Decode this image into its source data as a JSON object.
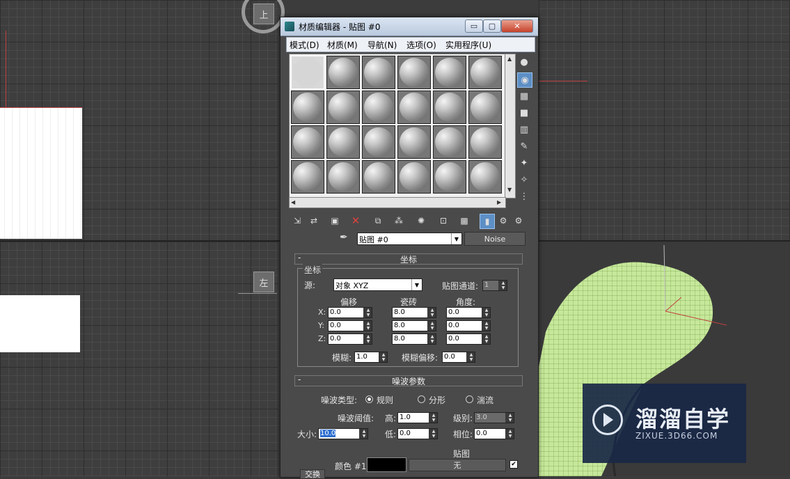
{
  "dialog": {
    "title": "材质编辑器 - 贴图 #0",
    "window_buttons": {
      "minimize": "▭",
      "maximize": "▢",
      "close": "✕"
    }
  },
  "menu": [
    "模式(D)",
    "材质(M)",
    "导航(N)",
    "选项(O)",
    "实用程序(U)"
  ],
  "viewports": {
    "top_left_label": "上",
    "left_label": "左"
  },
  "map_row": {
    "map_name": "贴图 #0",
    "map_type": "Noise"
  },
  "coordinates": {
    "header": "坐标",
    "group_label": "坐标",
    "source_label": "源:",
    "source_value": "对象 XYZ",
    "map_channel_label": "贴图通道:",
    "map_channel_value": "1",
    "col_offset": "偏移",
    "col_tiling": "瓷砖",
    "col_angle": "角度:",
    "rows": [
      {
        "axis": "X:",
        "offset": "0.0",
        "tiling": "8.0",
        "angle": "0.0"
      },
      {
        "axis": "Y:",
        "offset": "0.0",
        "tiling": "8.0",
        "angle": "0.0"
      },
      {
        "axis": "Z:",
        "offset": "0.0",
        "tiling": "8.0",
        "angle": "0.0"
      }
    ],
    "blur_label": "模糊:",
    "blur_value": "1.0",
    "blur_offset_label": "模糊偏移:",
    "blur_offset_value": "0.0"
  },
  "noise": {
    "header": "噪波参数",
    "type_label": "噪波类型:",
    "types": [
      "规则",
      "分形",
      "湍流"
    ],
    "selected_type": "规则",
    "threshold_label": "噪波阈值:",
    "high_label": "高:",
    "high_value": "1.0",
    "levels_label": "级别:",
    "levels_value": "3.0",
    "size_label": "大小:",
    "size_value": "10.0",
    "low_label": "低:",
    "low_value": "0.0",
    "phase_label": "相位:",
    "phase_value": "0.0",
    "maps_label": "贴图",
    "color1_label": "颜色 #1",
    "color1_value": "#000000",
    "map_none": "无",
    "swap_label": "交换"
  },
  "watermark": {
    "title": "溜溜自学",
    "subtitle": "ZIXUE.3D66.COM"
  },
  "colors": {
    "wire_green": "#c6e89a",
    "accent_blue": "#5d8fc6"
  }
}
